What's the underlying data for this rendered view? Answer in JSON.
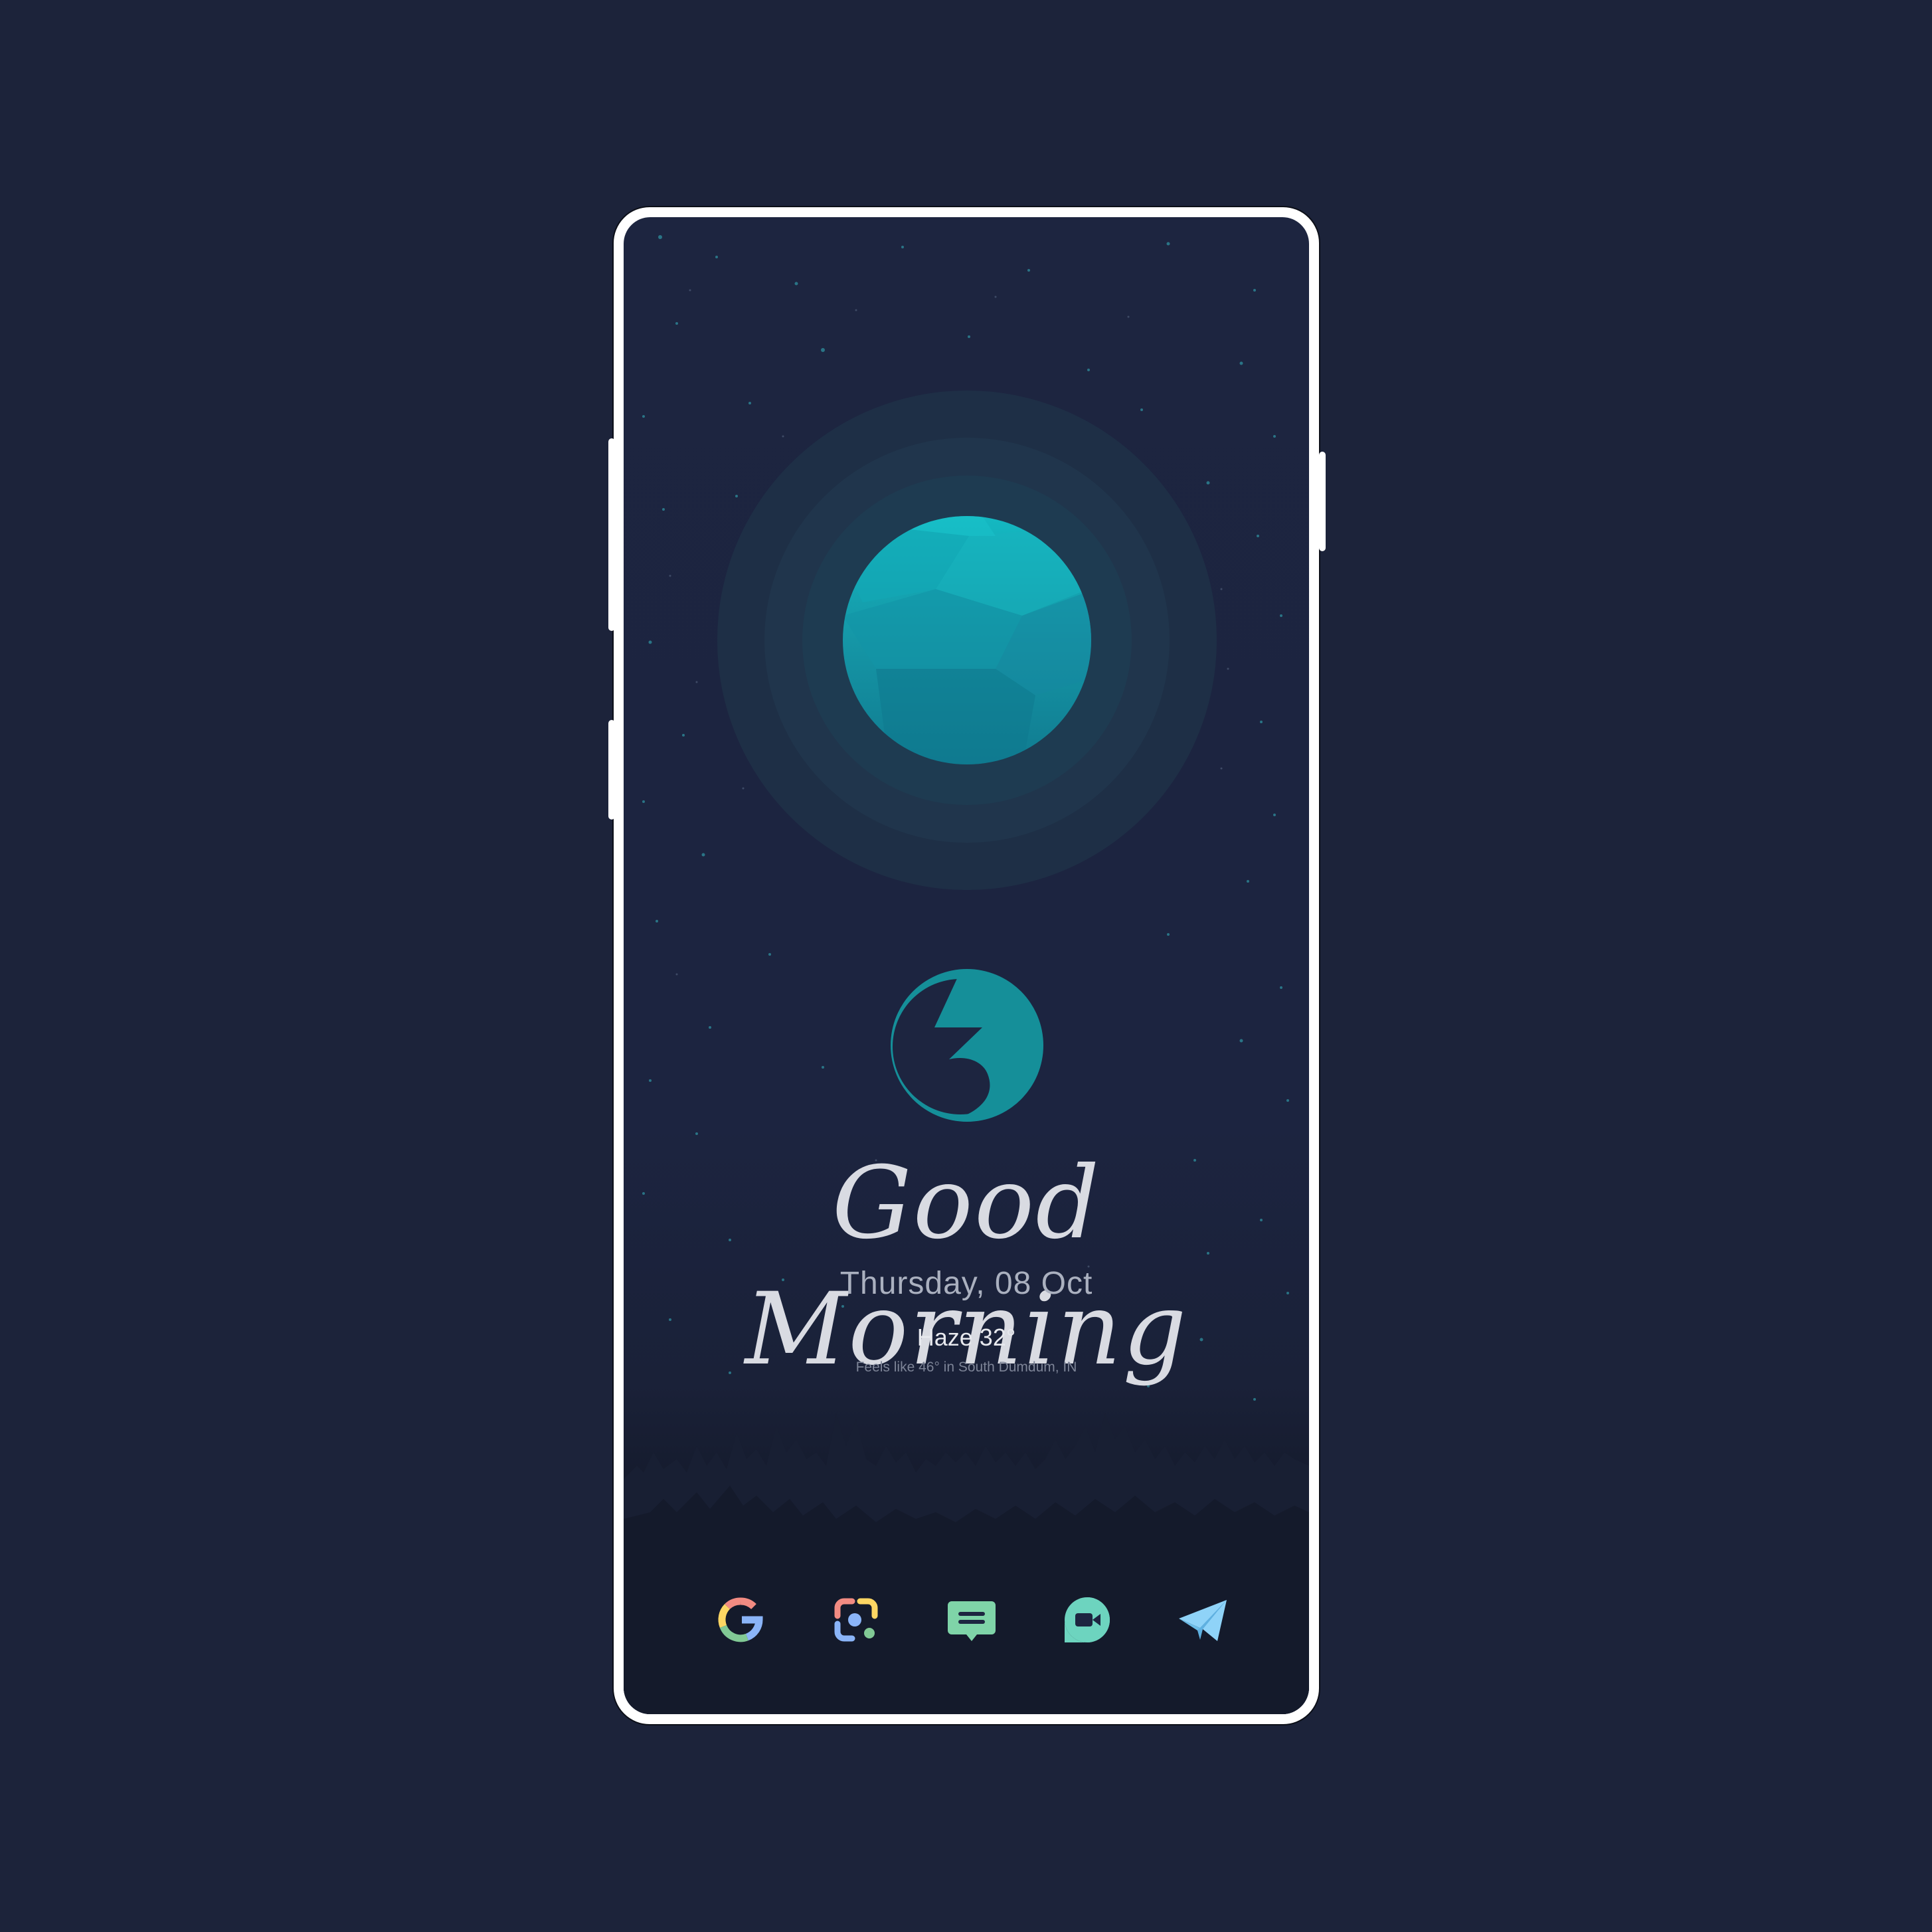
{
  "home_screen": {
    "greeting": "Good Morning",
    "date": "Thursday, 08 Oct",
    "weather": {
      "summary": "Haze 32°",
      "details": "Feels like 46° in South Dumdum, IN"
    },
    "dock_apps": [
      {
        "name": "google",
        "icon": "google-g-icon"
      },
      {
        "name": "lens",
        "icon": "lens-scanner-icon"
      },
      {
        "name": "messages",
        "icon": "message-bubble-icon"
      },
      {
        "name": "duo",
        "icon": "video-call-icon"
      },
      {
        "name": "telegram",
        "icon": "paper-plane-icon"
      }
    ]
  },
  "colors": {
    "background": "#1c233a",
    "screen": "#1d2540",
    "accent_teal": "#16a3ad",
    "greeting_text": "#d9dbe2",
    "forest": "#141a2b"
  }
}
